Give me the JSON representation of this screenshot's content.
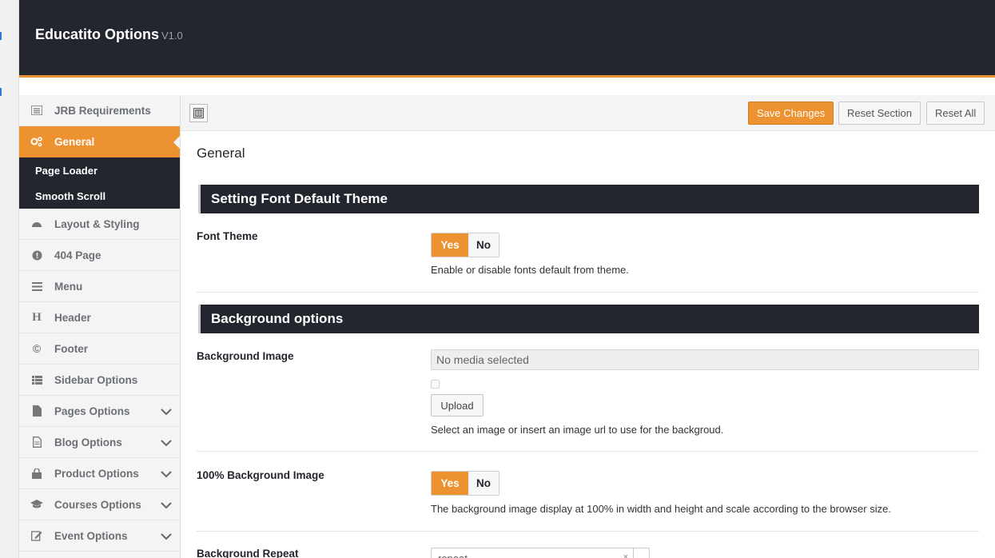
{
  "header": {
    "title": "Educatito Options",
    "version": "V1.0"
  },
  "sidebar": {
    "items": [
      {
        "label": "JRB Requirements",
        "icon": "list-icon"
      },
      {
        "label": "General",
        "icon": "gears-icon",
        "active": true
      },
      {
        "label": "Layout & Styling",
        "icon": "palette-icon"
      },
      {
        "label": "404 Page",
        "icon": "exclamation-circle-icon"
      },
      {
        "label": "Menu",
        "icon": "hamburger-icon"
      },
      {
        "label": "Header",
        "icon": "header-h-icon"
      },
      {
        "label": "Footer",
        "icon": "copyright-icon"
      },
      {
        "label": "Sidebar Options",
        "icon": "list-columns-icon"
      },
      {
        "label": "Pages Options",
        "icon": "file-icon",
        "expandable": true
      },
      {
        "label": "Blog Options",
        "icon": "file-text-icon",
        "expandable": true
      },
      {
        "label": "Product Options",
        "icon": "shopping-bag-icon",
        "expandable": true
      },
      {
        "label": "Courses Options",
        "icon": "graduation-cap-icon",
        "expandable": true
      },
      {
        "label": "Event Options",
        "icon": "edit-icon",
        "expandable": true
      }
    ],
    "subitems": [
      {
        "label": "Page Loader"
      },
      {
        "label": "Smooth Scroll"
      }
    ]
  },
  "toolbar": {
    "save_label": "Save Changes",
    "reset_section_label": "Reset Section",
    "reset_all_label": "Reset All"
  },
  "main": {
    "title": "General",
    "sections": [
      {
        "heading": "Setting Font Default Theme"
      },
      {
        "heading": "Background options"
      }
    ],
    "fields": {
      "font_theme": {
        "label": "Font Theme",
        "yes": "Yes",
        "no": "No",
        "selected": "Yes",
        "description": "Enable or disable fonts default from theme."
      },
      "background_image": {
        "label": "Background Image",
        "placeholder": "No media selected",
        "upload_label": "Upload",
        "description": "Select an image or insert an image url to use for the backgroud."
      },
      "full_background": {
        "label": "100% Background Image",
        "yes": "Yes",
        "no": "No",
        "selected": "Yes",
        "description": "The background image display at 100% in width and height and scale according to the browser size."
      },
      "background_repeat": {
        "label": "Background Repeat",
        "value": "repeat"
      }
    }
  },
  "colors": {
    "accent": "#ec9230",
    "dark": "#23262e"
  }
}
